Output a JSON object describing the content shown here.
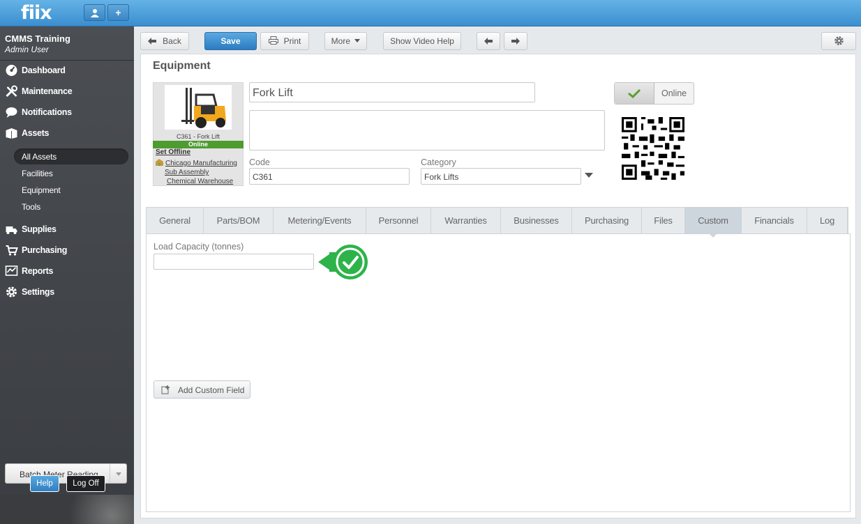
{
  "app": {
    "logo": "fiix",
    "user_icon": "user-icon",
    "add_label": "+"
  },
  "sidebar": {
    "org_name": "CMMS Training",
    "user_name": "Admin User",
    "items": [
      {
        "label": "Dashboard",
        "icon": "dashboard-icon"
      },
      {
        "label": "Maintenance",
        "icon": "tools-icon"
      },
      {
        "label": "Notifications",
        "icon": "chat-icon"
      },
      {
        "label": "Assets",
        "icon": "boxes-icon"
      },
      {
        "label": "Supplies",
        "icon": "truck-icon"
      },
      {
        "label": "Purchasing",
        "icon": "cart-icon"
      },
      {
        "label": "Reports",
        "icon": "chart-icon"
      },
      {
        "label": "Settings",
        "icon": "gear-icon"
      }
    ],
    "asset_subitems": [
      {
        "label": "All Assets"
      },
      {
        "label": "Facilities"
      },
      {
        "label": "Equipment"
      },
      {
        "label": "Tools"
      }
    ],
    "batch_label": "Batch Meter Reading",
    "help_label": "Help",
    "logoff_label": "Log Off"
  },
  "toolbar": {
    "back": "Back",
    "save": "Save",
    "print": "Print",
    "more": "More",
    "video_help": "Show Video Help"
  },
  "equipment": {
    "page_title": "Equipment",
    "image_caption": "C361 - Fork Lift",
    "status_bar": "Online",
    "set_offline": "Set Offline",
    "locations": [
      "Chicago Manufacturing",
      "Sub Assembly",
      "Chemical Warehouse"
    ],
    "name": "Fork Lift",
    "description": "",
    "code_label": "Code",
    "code_value": "C361",
    "category_label": "Category",
    "category_value": "Fork Lifts",
    "toggle_state": "Online"
  },
  "tabs": [
    "General",
    "Parts/BOM",
    "Metering/Events",
    "Personnel",
    "Warranties",
    "Businesses",
    "Purchasing",
    "Files",
    "Custom",
    "Financials",
    "Log"
  ],
  "active_tab": "Custom",
  "custom": {
    "field_label": "Load Capacity (tonnes)",
    "field_value": "",
    "add_button": "Add Custom Field"
  },
  "colors": {
    "accent": "#3b8fd0",
    "online_green": "#4e9b2f",
    "check_green": "#2db34a"
  }
}
